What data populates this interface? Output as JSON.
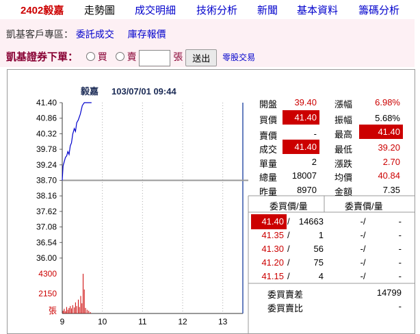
{
  "nav": {
    "stock": "2402毅嘉",
    "tabs": [
      "走勢圖",
      "成交明細",
      "技術分析",
      "新聞",
      "基本資料",
      "籌碼分析"
    ]
  },
  "links": {
    "prefix": "凱基客戶專區：",
    "entrust": "委託成交",
    "inventory": "庫存報價"
  },
  "order": {
    "label": "凱基證券下單：",
    "buy": "買",
    "sell": "賣",
    "unit": "張",
    "submit": "送出",
    "odd_lot": "零股交易"
  },
  "quote": {
    "open_label": "開盤",
    "open": "39.40",
    "bid_label": "買價",
    "bid": "41.40",
    "ask_label": "賣價",
    "ask": "-",
    "last_label": "成交",
    "last": "41.40",
    "vol_label": "單量",
    "vol": "2",
    "total_label": "總量",
    "total": "18007",
    "prevvol_label": "昨量",
    "prevvol": "8970",
    "chg_pct_label": "漲幅",
    "chg_pct": "6.98%",
    "amp_label": "振幅",
    "amp": "5.68%",
    "high_label": "最高",
    "high": "41.40",
    "low_label": "最低",
    "low": "39.20",
    "change_label": "漲跌",
    "change": "2.70",
    "avg_label": "均價",
    "avg": "40.84",
    "amount_label": "金額",
    "amount": "7.35"
  },
  "book": {
    "bid_header": "委買價/量",
    "ask_header": "委賣價/量",
    "rows": [
      {
        "bid_price": "41.40",
        "bid_qty": "14663",
        "ask_price": "-",
        "ask_qty": "-"
      },
      {
        "bid_price": "41.35",
        "bid_qty": "1",
        "ask_price": "-",
        "ask_qty": "-"
      },
      {
        "bid_price": "41.30",
        "bid_qty": "56",
        "ask_price": "-",
        "ask_qty": "-"
      },
      {
        "bid_price": "41.20",
        "bid_qty": "75",
        "ask_price": "-",
        "ask_qty": "-"
      },
      {
        "bid_price": "41.15",
        "bid_qty": "4",
        "ask_price": "-",
        "ask_qty": "-"
      }
    ],
    "diff_label": "委買賣差",
    "diff": "14799",
    "ratio_label": "委買賣比",
    "ratio": "-"
  },
  "colors": {
    "up": "#cc0000",
    "line": "#0000cc",
    "ref": "#999999"
  },
  "chart_data": {
    "type": "line",
    "title": "毅嘉",
    "timestamp": "103/07/01 09:44",
    "xlabel": "",
    "ylabel": "",
    "x_ticks": [
      "9",
      "10",
      "11",
      "12",
      "13"
    ],
    "y_ticks": [
      "41.40",
      "40.86",
      "40.32",
      "39.78",
      "39.24",
      "38.70",
      "38.16",
      "37.62",
      "37.08",
      "36.54",
      "36.00"
    ],
    "ylim": [
      36.0,
      41.4
    ],
    "reference": 38.7,
    "vol_ticks": [
      "4300",
      "2150"
    ],
    "vol_unit": "張",
    "vol_max": 4300,
    "price_series": {
      "t": [
        9.0,
        9.02,
        9.05,
        9.08,
        9.11,
        9.14,
        9.17,
        9.2,
        9.23,
        9.26,
        9.3,
        9.33,
        9.36,
        9.4,
        9.45,
        9.5,
        9.55,
        9.6,
        9.65,
        9.73
      ],
      "v": [
        38.7,
        39.2,
        39.35,
        39.5,
        39.55,
        39.7,
        39.6,
        39.9,
        40.0,
        40.3,
        40.5,
        40.4,
        40.7,
        40.8,
        41.0,
        41.3,
        41.4,
        41.4,
        41.4,
        41.4
      ]
    },
    "volume_series": {
      "t": [
        9.02,
        9.05,
        9.08,
        9.11,
        9.14,
        9.17,
        9.2,
        9.23,
        9.26,
        9.3,
        9.33,
        9.36,
        9.4,
        9.43,
        9.46,
        9.49,
        9.52,
        9.55,
        9.58,
        9.62,
        9.66,
        9.7
      ],
      "v": [
        300,
        500,
        250,
        700,
        400,
        600,
        800,
        550,
        900,
        650,
        1200,
        800,
        1500,
        700,
        1900,
        1100,
        4300,
        2600,
        600,
        400,
        300,
        150
      ]
    }
  }
}
